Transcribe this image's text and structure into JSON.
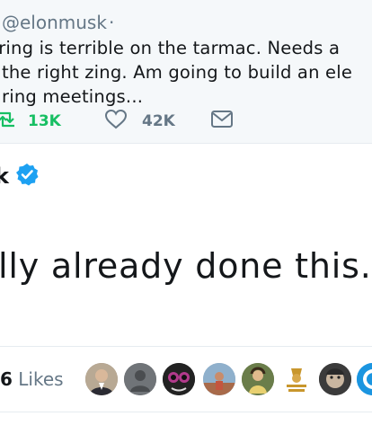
{
  "quoted_tweet": {
    "handle": "@elonmusk",
    "separator": "·",
    "lines": [
      "ering is terrible on the tarmac. Needs a",
      "the right zing. Am going to build an ele",
      "ring meetings..."
    ],
    "retweets": "13K",
    "likes": "42K"
  },
  "tweet": {
    "name_fragment": "k",
    "body": "lly already done this... I"
  },
  "likes_bar": {
    "count": "6",
    "label": "Likes"
  },
  "colors": {
    "retweet_green": "#17bf63",
    "verified_blue": "#1da1f2",
    "muted_gray": "#657786",
    "quoted_bg": "#f5f8fa"
  }
}
